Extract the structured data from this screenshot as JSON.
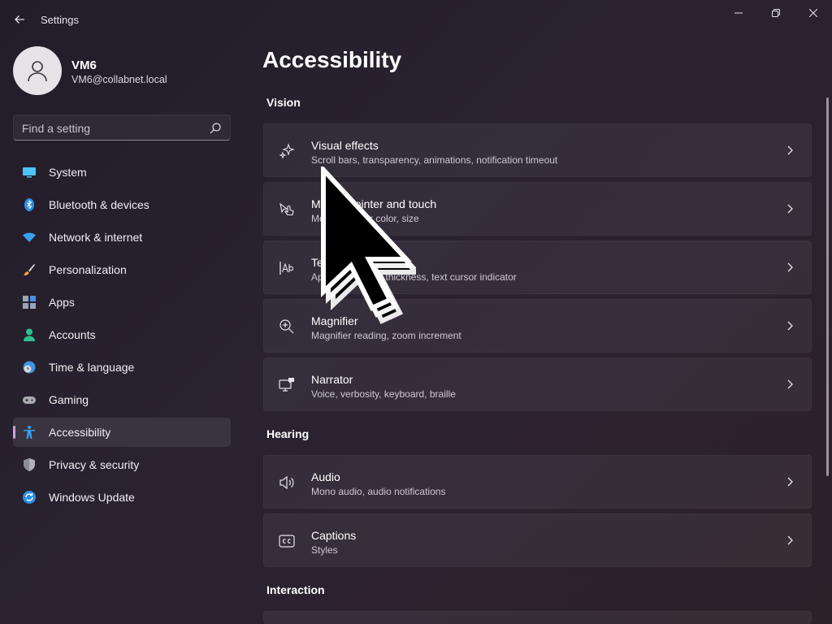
{
  "window": {
    "title": "Settings"
  },
  "profile": {
    "name": "VM6",
    "email": "VM6@collabnet.local"
  },
  "search": {
    "placeholder": "Find a setting"
  },
  "sidebar": {
    "items": [
      {
        "label": "System",
        "icon": "monitor-icon"
      },
      {
        "label": "Bluetooth & devices",
        "icon": "bluetooth-icon"
      },
      {
        "label": "Network & internet",
        "icon": "wifi-icon"
      },
      {
        "label": "Personalization",
        "icon": "brush-icon"
      },
      {
        "label": "Apps",
        "icon": "apps-icon"
      },
      {
        "label": "Accounts",
        "icon": "person-icon"
      },
      {
        "label": "Time & language",
        "icon": "globe-clock-icon"
      },
      {
        "label": "Gaming",
        "icon": "gamepad-icon"
      },
      {
        "label": "Accessibility",
        "icon": "accessibility-icon",
        "active": true
      },
      {
        "label": "Privacy & security",
        "icon": "shield-icon"
      },
      {
        "label": "Windows Update",
        "icon": "update-icon"
      }
    ]
  },
  "main": {
    "title": "Accessibility",
    "sections": [
      {
        "heading": "Vision",
        "cards": [
          {
            "title": "Visual effects",
            "subtitle": "Scroll bars, transparency, animations, notification timeout",
            "icon": "sparkle-icon"
          },
          {
            "title": "Mouse pointer and touch",
            "subtitle": "Mouse pointer color, size",
            "icon": "pointer-touch-icon"
          },
          {
            "title": "Text cursor",
            "subtitle": "Appearance and thickness, text cursor indicator",
            "icon": "text-cursor-icon"
          },
          {
            "title": "Magnifier",
            "subtitle": "Magnifier reading, zoom increment",
            "icon": "magnifier-icon"
          },
          {
            "title": "Narrator",
            "subtitle": "Voice, verbosity, keyboard, braille",
            "icon": "narrator-icon"
          }
        ]
      },
      {
        "heading": "Hearing",
        "cards": [
          {
            "title": "Audio",
            "subtitle": "Mono audio, audio notifications",
            "icon": "speaker-icon"
          },
          {
            "title": "Captions",
            "subtitle": "Styles",
            "icon": "captions-icon"
          }
        ]
      },
      {
        "heading": "Interaction",
        "cards": []
      }
    ]
  },
  "colors": {
    "accent": "#c9a0dc",
    "background": "#261f2b",
    "card": "#322b37"
  }
}
